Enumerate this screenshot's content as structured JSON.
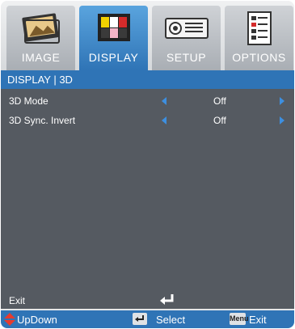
{
  "tabs": [
    {
      "label": "IMAGE",
      "icon": "image-icon",
      "active": false
    },
    {
      "label": "DISPLAY",
      "icon": "display-icon",
      "active": true
    },
    {
      "label": "SETUP",
      "icon": "projector-icon",
      "active": false
    },
    {
      "label": "OPTIONS",
      "icon": "options-icon",
      "active": false
    }
  ],
  "header": {
    "title": "DISPLAY | 3D"
  },
  "rows": [
    {
      "label": "3D Mode",
      "value": "Off"
    },
    {
      "label": "3D Sync. Invert",
      "value": "Off"
    }
  ],
  "exit": {
    "label": "Exit"
  },
  "footer": {
    "updown": "UpDown",
    "select": "Select",
    "menu_key": "Menu",
    "exit": "Exit"
  },
  "colors": {
    "accent": "#2f74b6",
    "panel": "#555a61",
    "arrow": "#3d8fe0",
    "updown": "#e63b2e"
  }
}
